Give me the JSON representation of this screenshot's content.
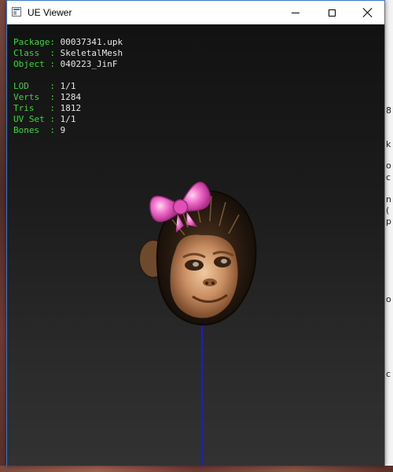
{
  "window": {
    "title": "UE Viewer"
  },
  "info": {
    "package": {
      "label": "Package:",
      "value": "00037341.upk"
    },
    "class": {
      "label": "Class  :",
      "value": "SkeletalMesh"
    },
    "object": {
      "label": "Object :",
      "value": "040223_JinF"
    },
    "lod": {
      "label": "LOD    :",
      "value": "1/1"
    },
    "verts": {
      "label": "Verts  :",
      "value": "1284"
    },
    "tris": {
      "label": "Tris   :",
      "value": "1812"
    },
    "uvset": {
      "label": "UV Set :",
      "value": "1/1"
    },
    "bones": {
      "label": "Bones  :",
      "value": "9"
    }
  },
  "colors": {
    "label_green": "#38d838",
    "value_white": "#e8e8e8",
    "axis_blue": "#1b1bd0"
  },
  "model": {
    "icon": "monkey-head-with-pink-bow"
  }
}
